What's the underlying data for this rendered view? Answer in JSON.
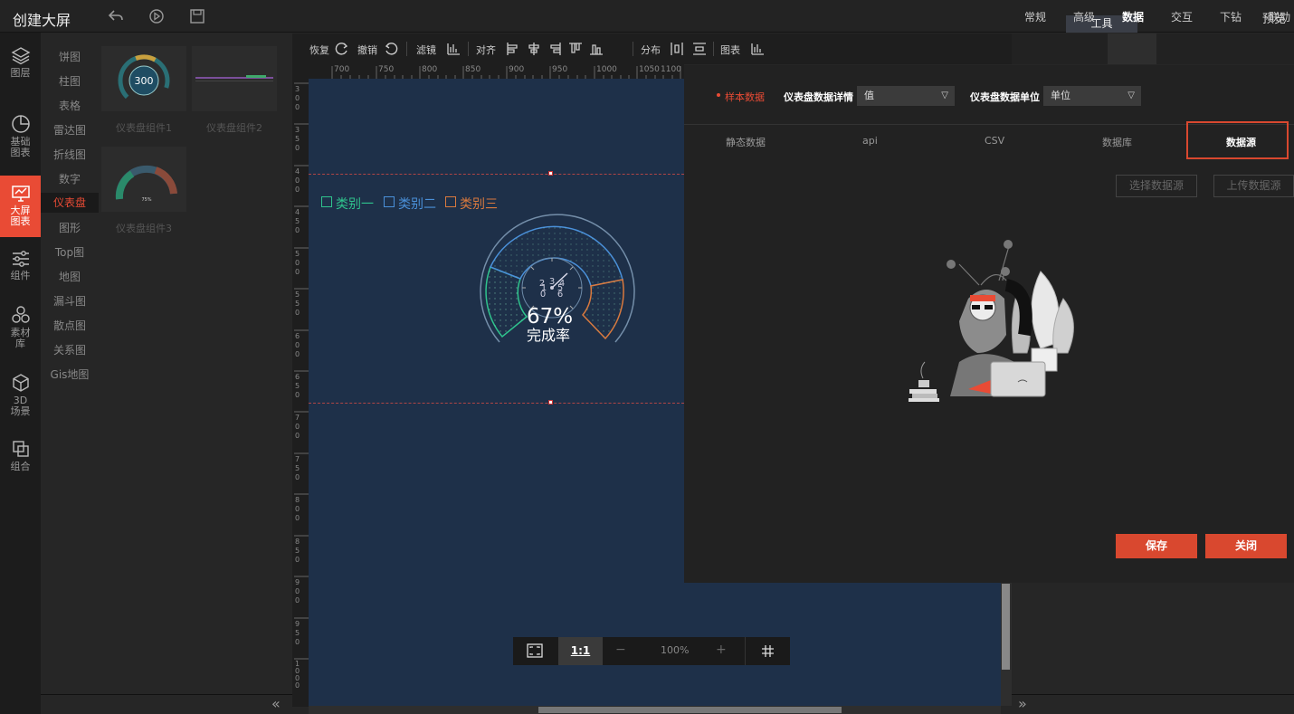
{
  "app": {
    "title": "创建大屏",
    "preview": "预览",
    "tool_tab": "工具"
  },
  "nav": [
    {
      "label": "图层",
      "icon": "layers-icon"
    },
    {
      "label": "基础\n图表",
      "icon": "pie-chart-icon"
    },
    {
      "label": "大屏\n图表",
      "icon": "screen-chart-icon"
    },
    {
      "label": "组件",
      "icon": "sliders-icon"
    },
    {
      "label": "素材\n库",
      "icon": "hexagons-icon"
    },
    {
      "label": "3D\n场景",
      "icon": "cube-icon"
    },
    {
      "label": "组合",
      "icon": "combine-icon"
    }
  ],
  "categories": [
    "饼图",
    "柱图",
    "表格",
    "雷达图",
    "折线图",
    "数字",
    "仪表盘",
    "图形",
    "Top图",
    "地图",
    "漏斗图",
    "散点图",
    "关系图",
    "Gis地图"
  ],
  "components": [
    {
      "label": "仪表盘组件1",
      "value": "300"
    },
    {
      "label": "仪表盘组件2"
    },
    {
      "label": "仪表盘组件3",
      "value": "75%"
    }
  ],
  "toolbar": {
    "redo": "恢复",
    "undo": "撤销",
    "filter": "滤镜",
    "align": "对齐",
    "distribute": "分布",
    "chart": "图表"
  },
  "ruler_h": [
    "700",
    "750",
    "800",
    "850",
    "900",
    "950",
    "1000",
    "1050",
    "1100"
  ],
  "ruler_v": [
    "300",
    "350",
    "400",
    "450",
    "500",
    "550",
    "600",
    "650",
    "700",
    "750",
    "800",
    "850",
    "900",
    "950",
    "1000"
  ],
  "gauge": {
    "legend": [
      {
        "name": "类别一",
        "color": "#2fc38d"
      },
      {
        "name": "类别二",
        "color": "#4a90d9"
      },
      {
        "name": "类别三",
        "color": "#d9793e"
      }
    ],
    "percent": "67%",
    "label": "完成率",
    "dial": {
      "top": "3",
      "upper_left": "2",
      "upper_right": "4",
      "lower_left": "1",
      "lower_right": "5",
      "bottom_left": "0",
      "bottom_right": "6"
    }
  },
  "zoom": {
    "ratio_btn": "1:1",
    "minus": "−",
    "level": "100%",
    "plus": "+"
  },
  "props_tabs": [
    "常规",
    "高级",
    "数据",
    "交互",
    "下钻",
    "联动"
  ],
  "modal": {
    "sample_label": "样本数据",
    "detail_label": "仪表盘数据详情",
    "detail_value": "值",
    "unit_label": "仪表盘数据单位",
    "unit_value": "单位",
    "source_tabs": [
      "静态数据",
      "api",
      "CSV",
      "数据库",
      "数据源"
    ],
    "select_btn": "选择数据源",
    "upload_btn": "上传数据源",
    "save_btn": "保存",
    "close_btn": "关闭"
  },
  "colors": {
    "accent": "#e94b35",
    "canvas": "#1e3049",
    "button": "#d9482f"
  }
}
